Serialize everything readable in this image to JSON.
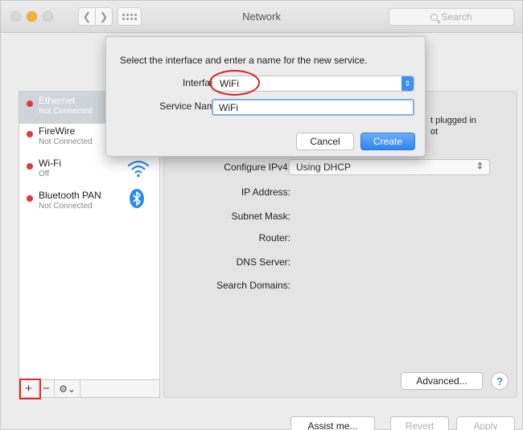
{
  "window": {
    "title": "Network",
    "search_placeholder": "Search"
  },
  "sidebar": {
    "services": [
      {
        "name": "Ethernet",
        "status": "Not Connected",
        "status_color": "#e5383b",
        "selected": true
      },
      {
        "name": "FireWire",
        "status": "Not Connected",
        "status_color": "#e5383b"
      },
      {
        "name": "Wi-Fi",
        "status": "Off",
        "status_color": "#e5383b",
        "icon": "wifi-icon"
      },
      {
        "name": "Bluetooth PAN",
        "status": "Not Connected",
        "status_color": "#e5383b",
        "icon": "bluetooth-icon"
      }
    ],
    "toolbar": {
      "add": "+",
      "remove": "−",
      "actions": "⚙⌄"
    }
  },
  "detail": {
    "status_partial_line1": "t plugged in",
    "status_partial_line2": "ot",
    "configure_ipv4_label": "Configure IPv4:",
    "configure_ipv4_value": "Using DHCP",
    "ip_address_label": "IP Address:",
    "subnet_mask_label": "Subnet Mask:",
    "router_label": "Router:",
    "dns_server_label": "DNS Server:",
    "search_domains_label": "Search Domains:",
    "advanced_label": "Advanced...",
    "help_label": "?"
  },
  "footer": {
    "assist_label": "Assist me...",
    "revert_label": "Revert",
    "apply_label": "Apply"
  },
  "sheet": {
    "prompt": "Select the interface and enter a name for the new service.",
    "interface_label": "Interface:",
    "interface_value": "WiFi",
    "service_name_label": "Service Name:",
    "service_name_value": "WiFi",
    "cancel_label": "Cancel",
    "create_label": "Create"
  },
  "colors": {
    "accent": "#2f84f1",
    "annotation": "#e02a2a"
  }
}
